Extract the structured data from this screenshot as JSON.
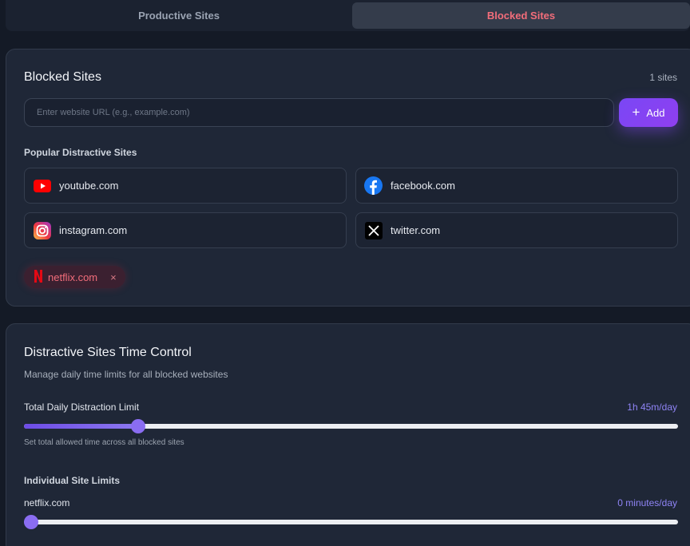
{
  "tabs": {
    "productive_label": "Productive Sites",
    "blocked_label": "Blocked Sites",
    "active": "blocked"
  },
  "blocked": {
    "title": "Blocked Sites",
    "count": "1 sites",
    "input": {
      "value": "",
      "placeholder": "Enter website URL (e.g., example.com)"
    },
    "add_label": "Add",
    "popular_label": "Popular Distractive Sites",
    "popular_sites": [
      {
        "name": "youtube.com",
        "icon": "youtube-icon"
      },
      {
        "name": "facebook.com",
        "icon": "facebook-icon"
      },
      {
        "name": "instagram.com",
        "icon": "instagram-icon"
      },
      {
        "name": "twitter.com",
        "icon": "x-twitter-icon"
      }
    ],
    "blocked_chips": [
      {
        "name": "netflix.com",
        "icon": "netflix-icon",
        "remove": "×"
      }
    ]
  },
  "time_control": {
    "title": "Distractive Sites Time Control",
    "subtitle": "Manage daily time limits for all blocked websites",
    "total_label": "Total Daily Distraction Limit",
    "total_value": "1h 45m/day",
    "total_fraction": 0.175,
    "total_hint": "Set total allowed time across all blocked sites",
    "individual_label": "Individual Site Limits",
    "sites": [
      {
        "name": "netflix.com",
        "value": "0 minutes/day",
        "fraction": 0
      }
    ]
  },
  "colors": {
    "accent": "#7a47f5",
    "blocked_tab_text": "#f26d7a",
    "value_text": "#8f84f5"
  }
}
